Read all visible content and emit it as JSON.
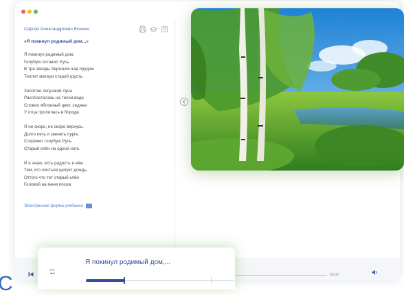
{
  "window": {
    "traffic_lights": [
      "#f25f5c",
      "#f5bb3a",
      "#57c24b"
    ]
  },
  "left_panel": {
    "author": "Сергей Александрович Есенин",
    "poem_title": "«Я покинул родимый дом...»",
    "tool_icons": [
      "printer-icon",
      "graduation-cap-icon",
      "notes-icon"
    ],
    "stanzas": [
      [
        "Я покинул родимый дом,",
        "Голубую оставил Русь.",
        "В три звезды березняк над прудом",
        "Теплит матери старой грусть."
      ],
      [
        "Золотою лягушкой луна",
        "Распласталась на тихой воде.",
        "Словно яблонный цвет, седина",
        "У отца пролилась в бороде."
      ],
      [
        "Я не скоро, не скоро вернусь.",
        "Долго петь и звенеть пурге.",
        "Стережет голубую Русь",
        "Старый клён на одной ноге."
      ],
      [
        "И я знаю, есть радость в нём",
        "Тем, кто листьев целует дождь,",
        "Оттого что тот старый клён",
        "Головой на меня похож."
      ]
    ],
    "etextbook_link": "Электронная форма учебника"
  },
  "photo": {
    "subject": "summer landscape with birch trees by a pond"
  },
  "player": {
    "track_title": "Я покинул родимый дом,...",
    "time_right": "00:06",
    "progress_fraction": 0.26,
    "accent_color": "#2f4f9a"
  },
  "corner_glyph": "C"
}
